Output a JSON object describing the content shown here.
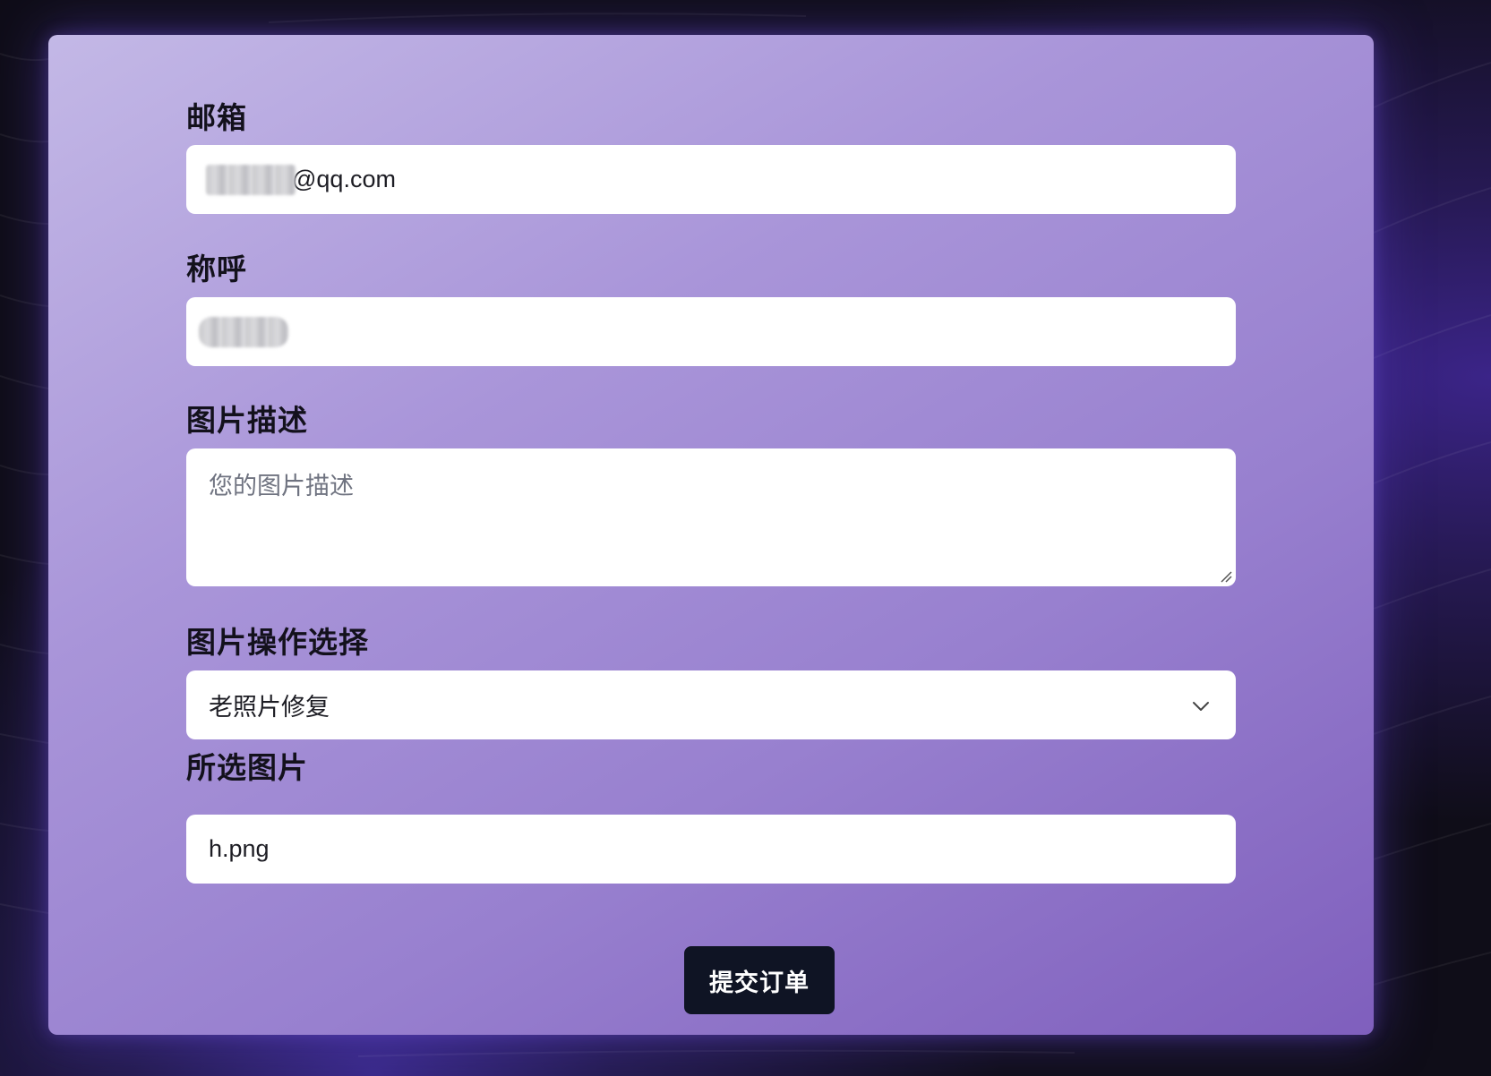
{
  "form": {
    "email": {
      "label": "邮箱",
      "value": "@qq.com"
    },
    "nickname": {
      "label": "称呼",
      "value": ""
    },
    "description": {
      "label": "图片描述",
      "placeholder": "您的图片描述"
    },
    "operation": {
      "label": "图片操作选择",
      "selected": "老照片修复"
    },
    "selected_image": {
      "label": "所选图片",
      "filename": "h.png"
    },
    "submit_label": "提交订单"
  },
  "colors": {
    "card_gradient_start": "#c3b8e6",
    "card_gradient_end": "#7f5fbd",
    "button_bg": "#0f1424",
    "page_bg": "#0f0d18"
  },
  "icons": {
    "select_arrow": "chevron-down-icon",
    "textarea_grip": "resize-grip-icon"
  }
}
